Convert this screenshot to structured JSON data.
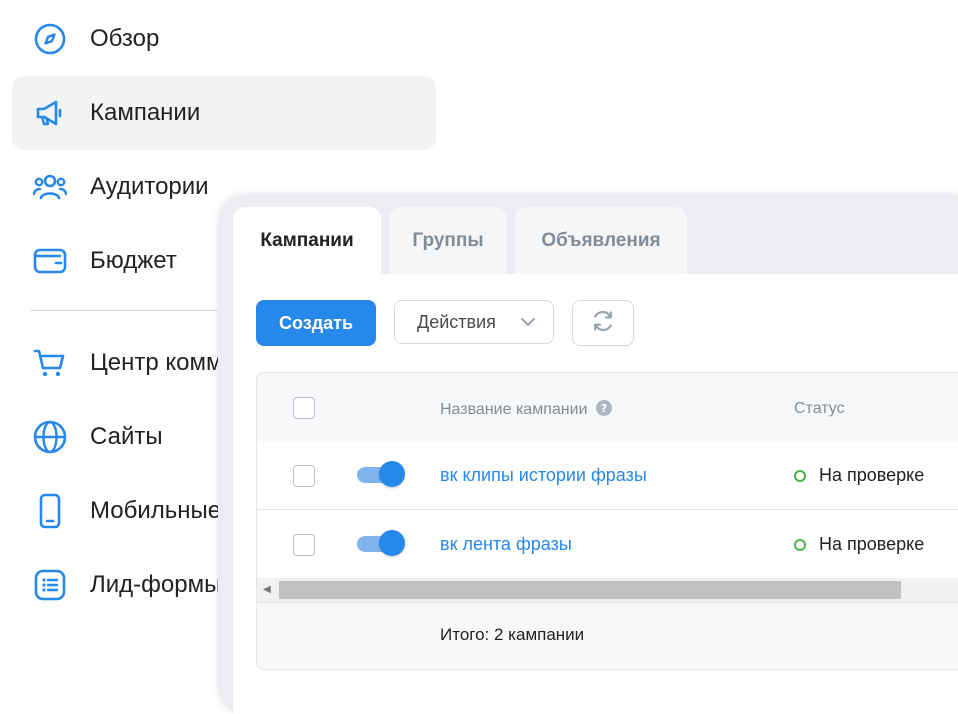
{
  "sidebar": {
    "items": [
      {
        "label": "Обзор",
        "icon": "compass-icon",
        "active": false
      },
      {
        "label": "Кампании",
        "icon": "megaphone-icon",
        "active": true
      },
      {
        "label": "Аудитории",
        "icon": "users-icon",
        "active": false
      },
      {
        "label": "Бюджет",
        "icon": "wallet-icon",
        "active": false
      },
      {
        "label": "Центр комм",
        "icon": "cart-icon",
        "active": false
      },
      {
        "label": "Сайты",
        "icon": "globe-icon",
        "active": false
      },
      {
        "label": "Мобильные",
        "icon": "phone-icon",
        "active": false
      },
      {
        "label": "Лид-формы",
        "icon": "list-icon",
        "active": false
      }
    ]
  },
  "tabs": [
    {
      "label": "Кампании",
      "active": true
    },
    {
      "label": "Группы",
      "active": false
    },
    {
      "label": "Объявления",
      "active": false
    }
  ],
  "toolbar": {
    "create_label": "Создать",
    "actions_label": "Действия"
  },
  "table": {
    "columns": [
      "Название кампании",
      "Статус"
    ],
    "rows": [
      {
        "name": "вк клипы истории фразы",
        "status": "На проверке",
        "enabled": true
      },
      {
        "name": "вк лента фразы",
        "status": "На проверке",
        "enabled": true
      }
    ],
    "total": "Итого: 2 кампании"
  },
  "colors": {
    "accent": "#2688eb",
    "status_ok": "#4bb34b",
    "active_bg": "#f2f3f5"
  }
}
